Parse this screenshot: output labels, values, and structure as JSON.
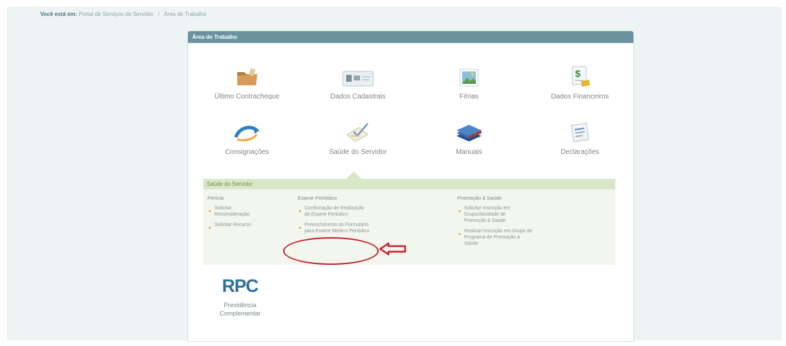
{
  "breadcrumb": {
    "lead": "Você está em:",
    "items": [
      "Portal de Serviços do Servidor",
      "Área de Trabalho"
    ],
    "separator": "/"
  },
  "panel": {
    "title": "Área de Trabalho"
  },
  "tiles": [
    {
      "label": "Último Contracheque",
      "icon": "folder-icon"
    },
    {
      "label": "Dados Cadastrais",
      "icon": "id-card-icon"
    },
    {
      "label": "Férias",
      "icon": "landscape-icon"
    },
    {
      "label": "Dados Financeiros",
      "icon": "money-document-icon"
    },
    {
      "label": "Consignações",
      "icon": "arrow-cycle-icon"
    },
    {
      "label": "Saúde do Servidor",
      "icon": "checklist-icon"
    },
    {
      "label": "Manuais",
      "icon": "books-icon"
    },
    {
      "label": "Declarações",
      "icon": "document-icon"
    }
  ],
  "submenu": {
    "title": "Saúde do Servidor",
    "columns": [
      {
        "title": "Perícia",
        "items": [
          "Solicitar Reconsideração",
          "Solicitar Recurso"
        ]
      },
      {
        "title": "Exame Periódico",
        "items": [
          "Confirmação de Realização de Exame Periódico",
          "Preenchimento do Formulário para Exame Médico Periódico"
        ]
      },
      {
        "title": "Promoção à Saúde",
        "items": [
          "Solicitar Inscrição em Grupo/Atividade de Promoção à Saúde",
          "Realizar Inscrição em Grupo de Programa de Promoção à Saúde"
        ]
      }
    ]
  },
  "rpc": {
    "logo_text": "RPC",
    "label": "Previdência Complementar"
  },
  "colors": {
    "header": "#6a939e",
    "submenu_header": "#d8e7c6",
    "annotation": "#c6202d",
    "rpc": "#2e6f9c"
  }
}
